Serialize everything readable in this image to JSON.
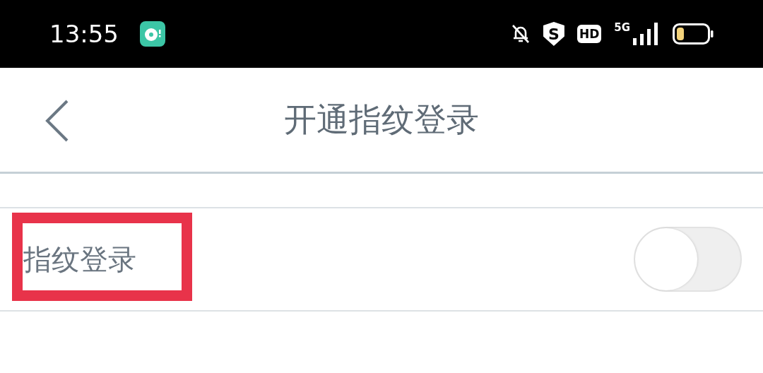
{
  "status_bar": {
    "time": "13:55",
    "shield_letter": "S",
    "hd": "HD",
    "network": "5G"
  },
  "header": {
    "title": "开通指纹登录"
  },
  "settings": [
    {
      "label": "指纹登录",
      "on": false,
      "highlighted": true
    }
  ]
}
